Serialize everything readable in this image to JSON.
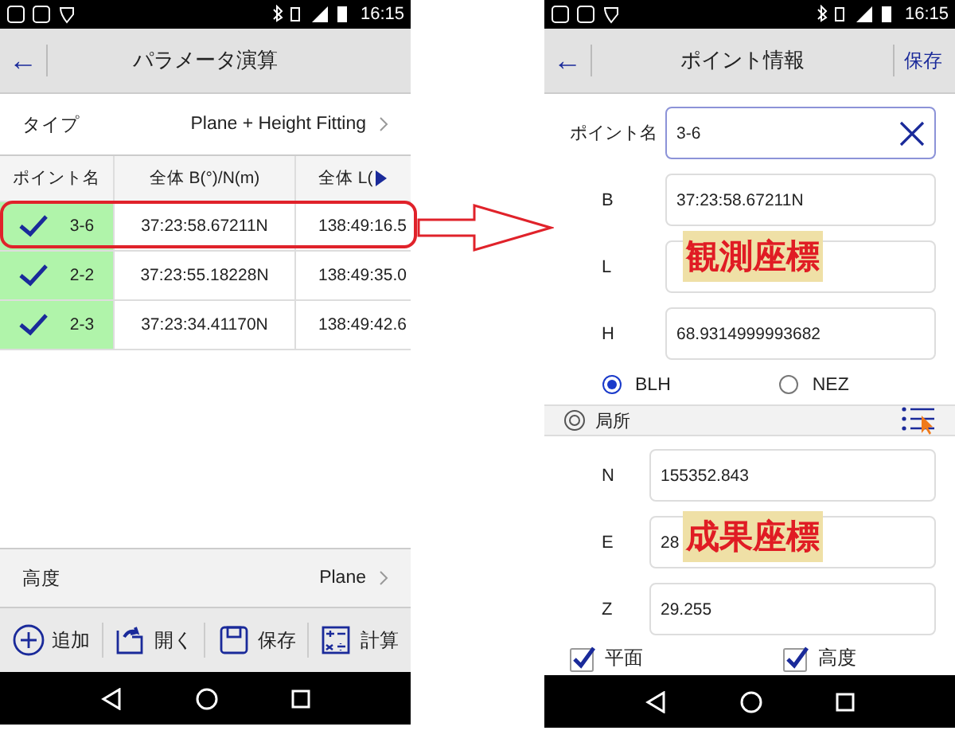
{
  "left_screen": {
    "status_bar": {
      "time": "16:15"
    },
    "header": {
      "back": "←",
      "title": "パラメータ演算"
    },
    "type_row": {
      "label": "タイプ",
      "value": "Plane + Height Fitting"
    },
    "table": {
      "columns": [
        "ポイント名",
        "全体 B(°)/N(m)",
        "全体 L("
      ],
      "rows": [
        {
          "checked": true,
          "name": "3-6",
          "b": "37:23:58.67211N",
          "l": "138:49:16.5",
          "highlighted": true
        },
        {
          "checked": true,
          "name": "2-2",
          "b": "37:23:55.18228N",
          "l": "138:49:35.0"
        },
        {
          "checked": true,
          "name": "2-3",
          "b": "37:23:34.41170N",
          "l": "138:49:42.6"
        }
      ]
    },
    "height_row": {
      "label": "高度",
      "value": "Plane"
    },
    "toolbar": [
      {
        "kind": "add",
        "label": "追加"
      },
      {
        "kind": "open",
        "label": "開く"
      },
      {
        "kind": "save",
        "label": "保存"
      },
      {
        "kind": "calc",
        "label": "計算"
      }
    ]
  },
  "right_screen": {
    "status_bar": {
      "time": "16:15"
    },
    "header": {
      "back": "←",
      "title": "ポイント情報",
      "action": "保存"
    },
    "point_name": {
      "label": "ポイント名",
      "value": "3-6"
    },
    "observed": [
      {
        "label": "B",
        "value": "37:23:58.67211N"
      },
      {
        "label": "L"
      },
      {
        "label": "H",
        "value": "68.9314999993682"
      }
    ],
    "modes": [
      {
        "label": "BLH",
        "selected": true
      },
      {
        "label": "NEZ",
        "selected": false
      }
    ],
    "section": {
      "title": "局所"
    },
    "result": [
      {
        "label": "N",
        "value": "155352.843"
      },
      {
        "label": "E",
        "value": "28"
      },
      {
        "label": "Z",
        "value": "29.255"
      }
    ],
    "options": [
      {
        "label": "平面",
        "checked": true
      },
      {
        "label": "高度",
        "checked": true
      }
    ]
  },
  "annotations": {
    "observed_label": "観測座標",
    "result_label": "成果座標"
  }
}
